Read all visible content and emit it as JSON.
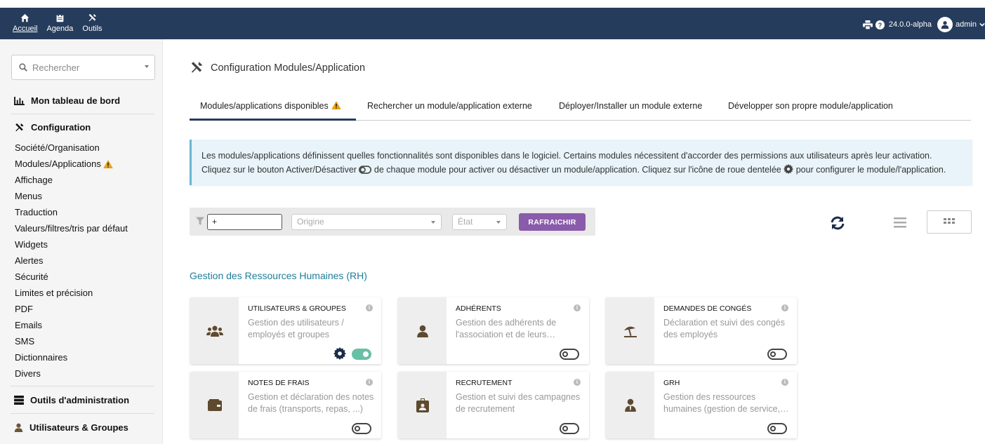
{
  "topbar": {
    "nav": [
      {
        "label": "Accueil",
        "icon": "home-icon"
      },
      {
        "label": "Agenda",
        "icon": "calendar-icon"
      },
      {
        "label": "Outils",
        "icon": "tools-icon"
      }
    ],
    "version": "24.0.0-alpha",
    "user": "admin"
  },
  "sidebar": {
    "search_placeholder": "Rechercher",
    "dashboard": "Mon tableau de bord",
    "configuration": "Configuration",
    "items": [
      "Société/Organisation",
      "Modules/Applications",
      "Affichage",
      "Menus",
      "Traduction",
      "Valeurs/filtres/tris par défaut",
      "Widgets",
      "Alertes",
      "Sécurité",
      "Limites et précision",
      "PDF",
      "Emails",
      "SMS",
      "Dictionnaires",
      "Divers"
    ],
    "admin_tools": "Outils d'administration",
    "users_groups": "Utilisateurs & Groupes"
  },
  "main": {
    "title": "Configuration Modules/Application",
    "tabs": [
      "Modules/applications disponibles",
      "Rechercher un module/application externe",
      "Déployer/Installer un module externe",
      "Développer son propre module/application"
    ],
    "info_line1": "Les modules/applications définissent quelles fonctionnalités sont disponibles dans le logiciel. Certains modules nécessitent d'accorder des permissions aux utilisateurs après leur activation.",
    "info_line2a": "Cliquez sur le bouton Activer/Désactiver",
    "info_line2b": "de chaque module pour activer ou désactiver un module/application. Cliquez sur l'icône de roue dentelée",
    "info_line2c": "pour configurer le module/l'application.",
    "filter": {
      "search_value": "+",
      "origin_placeholder": "Origine",
      "state_placeholder": "État",
      "refresh_label": "RAFRAICHIR"
    },
    "group_title": "Gestion des Ressources Humaines (RH)",
    "modules": [
      {
        "title": "UTILISATEURS & GROUPES",
        "desc": "Gestion des utilisateurs / employés et groupes",
        "enabled": true,
        "icon": "users-icon"
      },
      {
        "title": "ADHÉRENTS",
        "desc": "Gestion des adhérents de l'association et de leurs…",
        "enabled": false,
        "icon": "member-icon"
      },
      {
        "title": "DEMANDES DE CONGÉS",
        "desc": "Déclaration et suivi des congés des employés",
        "enabled": false,
        "icon": "beach-umbrella-icon"
      },
      {
        "title": "NOTES DE FRAIS",
        "desc": "Gestion et déclaration des notes de frais (transports, repas, ...)",
        "enabled": false,
        "icon": "wallet-icon"
      },
      {
        "title": "RECRUTEMENT",
        "desc": "Gestion et suivi des campagnes de recrutement",
        "enabled": false,
        "icon": "id-badge-icon"
      },
      {
        "title": "GRH",
        "desc": "Gestion des ressources humaines (gestion de service,…",
        "enabled": false,
        "icon": "employee-icon"
      }
    ]
  }
}
